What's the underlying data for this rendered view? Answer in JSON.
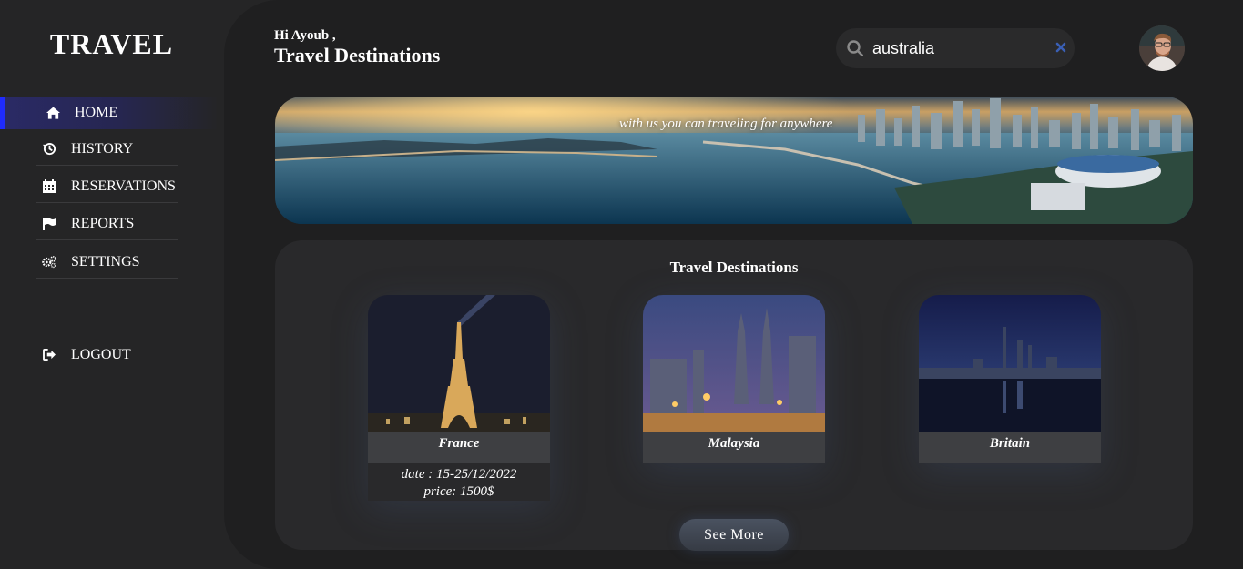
{
  "sidebar": {
    "brand": "TRAVEL",
    "items": [
      {
        "label": "HOME",
        "icon": "home-icon",
        "active": true
      },
      {
        "label": "HISTORY",
        "icon": "history-icon"
      },
      {
        "label": "RESERVATIONS",
        "icon": "calendar-icon"
      },
      {
        "label": "REPORTS",
        "icon": "flag-icon"
      },
      {
        "label": "SETTINGS",
        "icon": "gears-icon"
      }
    ],
    "logout": {
      "label": "LOGOUT",
      "icon": "logout-icon"
    }
  },
  "header": {
    "greeting": "Hi Ayoub ,",
    "title": "Travel Destinations"
  },
  "search": {
    "value": "australia",
    "icon": "search-icon",
    "clear_icon": "close-icon"
  },
  "banner": {
    "tagline": "with us you can traveling for anywhere"
  },
  "destinations": {
    "title": "Travel Destinations",
    "cards": [
      {
        "name": "France",
        "date": "date : 15-25/12/2022",
        "price": "price: 1500$"
      },
      {
        "name": "Malaysia"
      },
      {
        "name": "Britain"
      }
    ],
    "see_more": "See More"
  },
  "colors": {
    "accent": "#1f2bff",
    "background": "#1f1f20",
    "sidebar": "#252526"
  }
}
